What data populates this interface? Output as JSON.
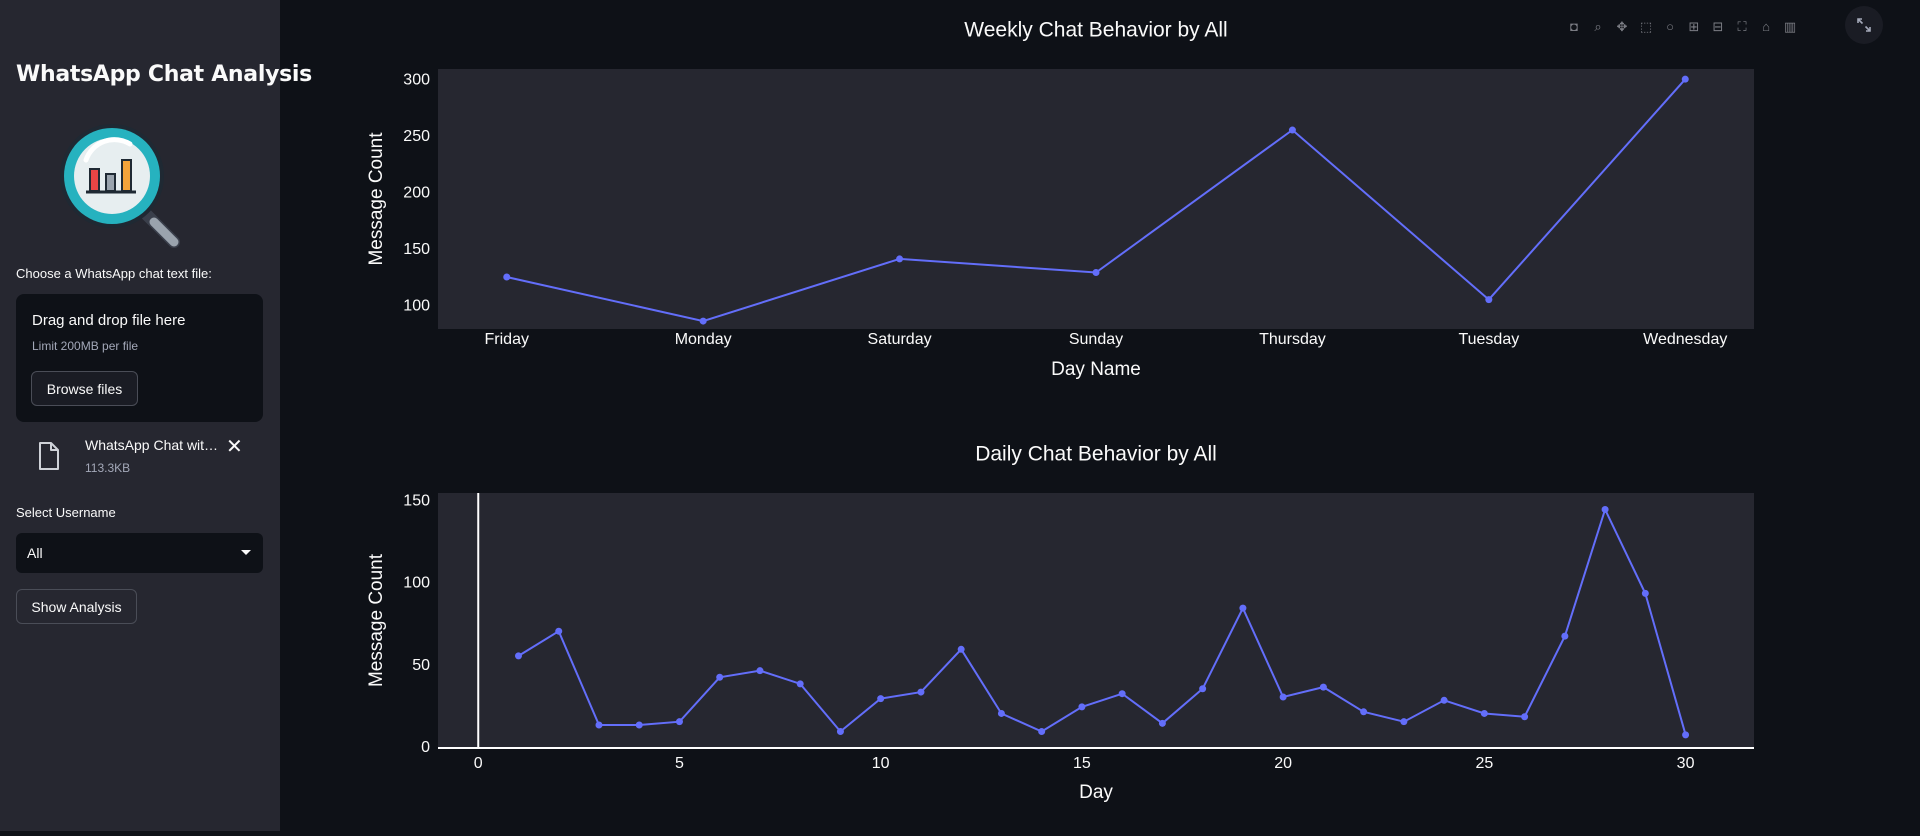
{
  "sidebar": {
    "title": "WhatsApp Chat Analysis",
    "uploader_label": "Choose a WhatsApp chat text file:",
    "dropzone": {
      "title": "Drag and drop file here",
      "limit": "Limit 200MB per file",
      "browse_label": "Browse files"
    },
    "uploaded_file": {
      "name": "WhatsApp Chat wit…",
      "size": "113.3KB",
      "icon": "file-icon"
    },
    "select_label": "Select Username",
    "select_value": "All",
    "show_button": "Show Analysis"
  },
  "toolbar": {
    "icons": [
      "camera-icon",
      "zoom-icon",
      "pan-icon",
      "box-select-icon",
      "lasso-icon",
      "zoom-in-icon",
      "zoom-out-icon",
      "autoscale-icon",
      "reset-axes-icon",
      "plotly-logo-icon"
    ]
  },
  "colors": {
    "line": "#636efa",
    "plot_bg": "#262730",
    "page_bg": "#0e1117",
    "sidebar_bg": "#262730"
  },
  "chart_data": [
    {
      "type": "line",
      "title": "Weekly Chat Behavior by All",
      "xlabel": "Day Name",
      "ylabel": "Message Count",
      "categories": [
        "Friday",
        "Monday",
        "Saturday",
        "Sunday",
        "Thursday",
        "Tuesday",
        "Wednesday"
      ],
      "values": [
        126,
        87,
        142,
        130,
        256,
        106,
        301
      ],
      "ylim": [
        80,
        310
      ],
      "yticks": [
        100,
        150,
        200,
        250,
        300
      ],
      "grid": false,
      "markers": true
    },
    {
      "type": "line",
      "title": "Daily Chat Behavior by All",
      "xlabel": "Day",
      "ylabel": "Message Count",
      "x": [
        1,
        2,
        3,
        4,
        5,
        6,
        7,
        8,
        9,
        10,
        11,
        12,
        13,
        14,
        15,
        16,
        17,
        18,
        19,
        20,
        21,
        22,
        23,
        24,
        25,
        26,
        27,
        28,
        29,
        30
      ],
      "values": [
        56,
        71,
        14,
        14,
        16,
        43,
        47,
        39,
        10,
        30,
        34,
        60,
        21,
        10,
        25,
        33,
        15,
        36,
        85,
        31,
        37,
        22,
        16,
        29,
        21,
        19,
        68,
        145,
        94,
        8
      ],
      "xlim": [
        -1,
        31.7
      ],
      "ylim": [
        0,
        155
      ],
      "xticks": [
        0,
        5,
        10,
        15,
        20,
        25,
        30
      ],
      "yticks": [
        0,
        50,
        100,
        150
      ],
      "grid": false,
      "markers": true
    }
  ]
}
